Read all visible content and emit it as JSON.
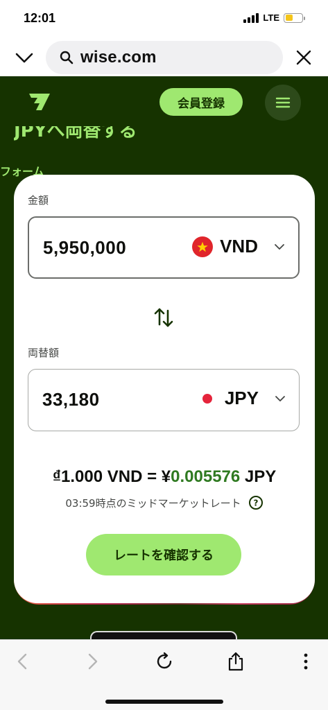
{
  "status": {
    "time": "12:01",
    "network": "LTE",
    "battery_level": 0.45
  },
  "browser": {
    "url": "wise.com"
  },
  "header": {
    "signup_label": "会員登録"
  },
  "background": {
    "heading_fragment": "JPYへ両替する",
    "subtext": "フォーム"
  },
  "converter": {
    "send_label": "金額",
    "send_amount": "5,950,000",
    "send_currency": "VND",
    "receive_label": "両替額",
    "receive_amount": "33,180",
    "receive_currency": "JPY",
    "rate_prefix": "₫1.000 VND = ¥",
    "rate_value": "0.005576",
    "rate_suffix": " JPY",
    "rate_note": "03:59時点のミッドマーケットレート",
    "confirm_label": "レートを確認する"
  },
  "colors": {
    "brand_dark": "#163300",
    "brand_green": "#9fe870",
    "rate_green": "#2f7a21"
  }
}
